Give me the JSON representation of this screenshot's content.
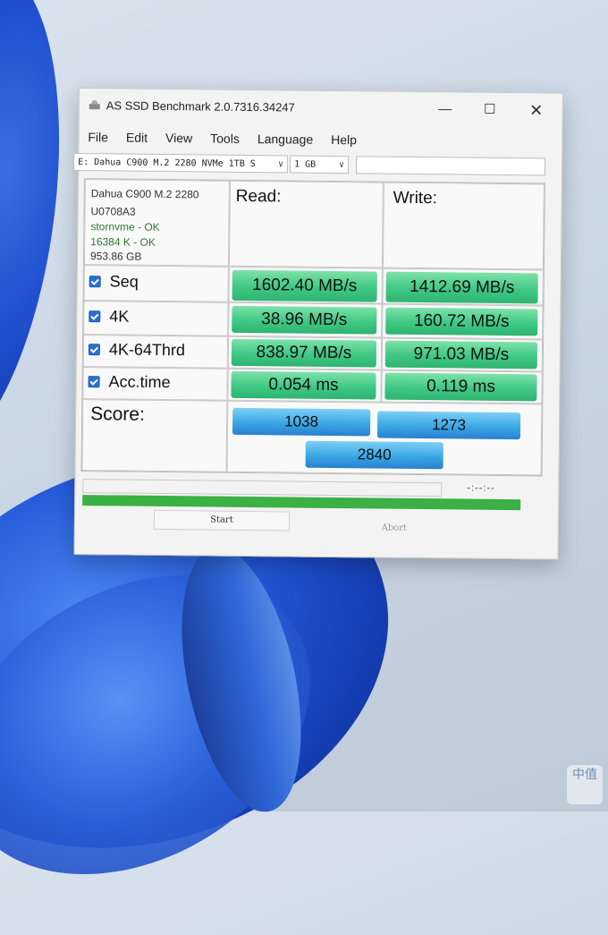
{
  "window": {
    "title": "AS SSD Benchmark 2.0.7316.34247"
  },
  "menu": [
    "File",
    "Edit",
    "View",
    "Tools",
    "Language",
    "Help"
  ],
  "toolbar": {
    "drive": "E: Dahua C900 M.2 2280 NVMe 1TB S",
    "size": "1 GB"
  },
  "drive_info": {
    "model": "Dahua C900 M.2 2280",
    "firmware": "U0708A3",
    "driver": "stornvme - OK",
    "alignment": "16384 K - OK",
    "capacity": "953.86 GB"
  },
  "columns": {
    "read": "Read:",
    "write": "Write:"
  },
  "rows": [
    {
      "label": "Seq",
      "read": "1602.40 MB/s",
      "write": "1412.69 MB/s"
    },
    {
      "label": "4K",
      "read": "38.96 MB/s",
      "write": "160.72 MB/s"
    },
    {
      "label": "4K-64Thrd",
      "read": "838.97 MB/s",
      "write": "971.03 MB/s"
    },
    {
      "label": "Acc.time",
      "read": "0.054 ms",
      "write": "0.119 ms"
    }
  ],
  "score": {
    "label": "Score:",
    "read": "1038",
    "write": "1273",
    "total": "2840"
  },
  "status": {
    "time": "-:--:--",
    "progress": 1.0
  },
  "buttons": {
    "start": "Start",
    "abort": "Abort"
  },
  "watermark": "中值"
}
